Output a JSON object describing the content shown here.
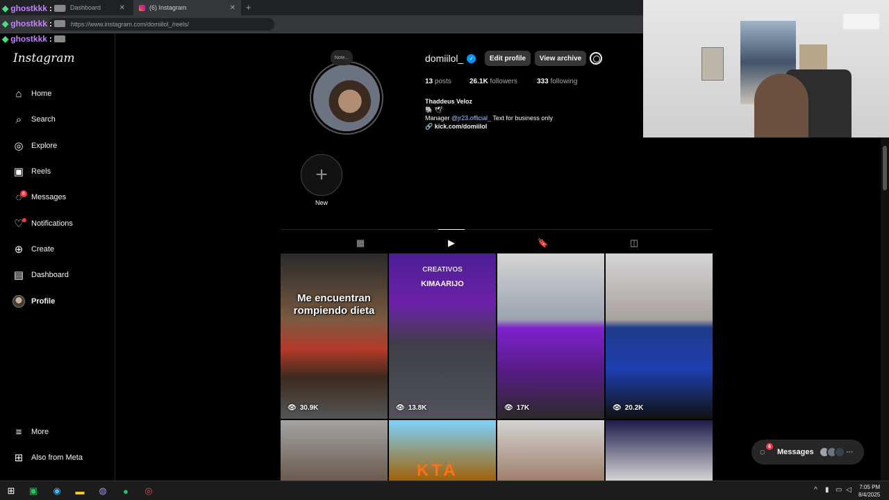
{
  "browser": {
    "tabs": [
      {
        "label": "Dashboard"
      },
      {
        "label": "(6) Instagram"
      }
    ],
    "url": "https://www.instagram.com/domiilol_/reels/"
  },
  "stream_chat": [
    {
      "user": "ghostkkk"
    },
    {
      "user": "ghostkkk"
    },
    {
      "user": "ghostkkk"
    }
  ],
  "sidebar": {
    "logo": "Instagram",
    "items": [
      {
        "label": "Home",
        "icon": "home-icon"
      },
      {
        "label": "Search",
        "icon": "search-icon"
      },
      {
        "label": "Explore",
        "icon": "compass-icon"
      },
      {
        "label": "Reels",
        "icon": "reels-icon"
      },
      {
        "label": "Messages",
        "icon": "messenger-icon",
        "badge": "6"
      },
      {
        "label": "Notifications",
        "icon": "heart-icon"
      },
      {
        "label": "Create",
        "icon": "plus-square-icon"
      },
      {
        "label": "Dashboard",
        "icon": "chart-icon"
      },
      {
        "label": "Profile",
        "icon": "avatar"
      }
    ],
    "more": "More",
    "also_from_meta": "Also from Meta"
  },
  "profile": {
    "note": "Note...",
    "username": "domiilol_",
    "edit_profile": "Edit profile",
    "view_archive": "View archive",
    "posts_count": "13",
    "posts_label": "posts",
    "followers_count": "26.1K",
    "followers_label": "followers",
    "following_count": "333",
    "following_label": "following",
    "full_name": "Thaddeus Veloz",
    "emoji_line": "🐘 🕊",
    "bio_prefix": "Manager",
    "bio_mention": "@jr23.official_",
    "bio_suffix": "Text for business only",
    "link": "kick.com/domiilol",
    "new_story_label": "New"
  },
  "reels": [
    {
      "views": "30.9K",
      "text": "Me encuentran rompiendo dieta"
    },
    {
      "views": "13.8K",
      "brand": "CREATIVOS",
      "brand2": "KIMAARIJO"
    },
    {
      "views": "17K"
    },
    {
      "views": "20.2K"
    },
    {
      "views": ""
    },
    {
      "views": "",
      "kta": "KTA"
    },
    {
      "views": ""
    },
    {
      "views": ""
    }
  ],
  "messages_pill": {
    "label": "Messages",
    "badge": "6"
  },
  "taskbar": {
    "time": "7:05 PM",
    "date": "8/4/2025"
  },
  "colors": {
    "accent": "#0095f6",
    "badge": "#ff3040",
    "background": "#000000"
  }
}
